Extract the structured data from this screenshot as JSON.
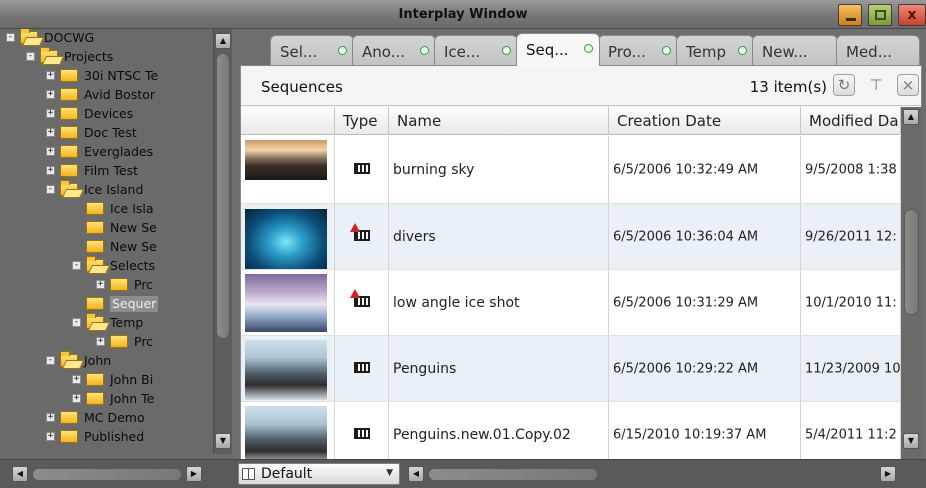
{
  "window": {
    "title": "Interplay Window",
    "close_glyph": "x"
  },
  "tree": [
    {
      "label": "DOCWG",
      "level": 0,
      "toggle": "-",
      "open": true
    },
    {
      "label": "Projects",
      "level": 1,
      "toggle": "-",
      "open": true
    },
    {
      "label": "30i NTSC Te",
      "level": 2,
      "toggle": "+",
      "open": false
    },
    {
      "label": "Avid Bostor",
      "level": 2,
      "toggle": "+",
      "open": false
    },
    {
      "label": "Devices",
      "level": 2,
      "toggle": "+",
      "open": false
    },
    {
      "label": "Doc Test",
      "level": 2,
      "toggle": "+",
      "open": false
    },
    {
      "label": "Everglades",
      "level": 2,
      "toggle": "+",
      "open": false
    },
    {
      "label": "Film Test",
      "level": 2,
      "toggle": "+",
      "open": false
    },
    {
      "label": "Ice Island",
      "level": 2,
      "toggle": "-",
      "open": true
    },
    {
      "label": "Ice Isla",
      "level": 3,
      "toggle": "",
      "open": false
    },
    {
      "label": "New Se",
      "level": 3,
      "toggle": "",
      "open": false
    },
    {
      "label": "New Se",
      "level": 3,
      "toggle": "",
      "open": false
    },
    {
      "label": "Selects",
      "level": 3,
      "toggle": "-",
      "open": true
    },
    {
      "label": "Prc",
      "level": 4,
      "toggle": "+",
      "open": false
    },
    {
      "label": "Sequer",
      "level": 3,
      "toggle": "",
      "open": false,
      "selected": true
    },
    {
      "label": "Temp",
      "level": 3,
      "toggle": "-",
      "open": true
    },
    {
      "label": "Prc",
      "level": 4,
      "toggle": "+",
      "open": false
    },
    {
      "label": "John",
      "level": 2,
      "toggle": "-",
      "open": true
    },
    {
      "label": "John Bi",
      "level": 3,
      "toggle": "+",
      "open": false
    },
    {
      "label": "John Te",
      "level": 3,
      "toggle": "+",
      "open": false
    },
    {
      "label": "MC Demo",
      "level": 2,
      "toggle": "+",
      "open": false
    },
    {
      "label": "Published",
      "level": 2,
      "toggle": "+",
      "open": false
    }
  ],
  "tabs": [
    {
      "label": "Sel...",
      "dot": true
    },
    {
      "label": "Ano...",
      "dot": true
    },
    {
      "label": "Ice...",
      "dot": true
    },
    {
      "label": "Seq...",
      "dot": true,
      "active": true
    },
    {
      "label": "Pro...",
      "dot": true
    },
    {
      "label": "Temp",
      "dot": true
    },
    {
      "label": "New...",
      "dot": false
    },
    {
      "label": "Med...",
      "dot": false
    }
  ],
  "panel": {
    "title": "Sequences",
    "item_count": "13 item(s)",
    "refresh_icon": "refresh-icon",
    "pin_icon": "pin-icon",
    "close_icon": "close-icon",
    "close_glyph": "×",
    "pin_glyph": "⊤",
    "refresh_glyph": "↻"
  },
  "columns": [
    "",
    "Type",
    "Name",
    "Creation Date",
    "Modified Da"
  ],
  "rows": [
    {
      "name": "burning sky",
      "created": "6/5/2006 10:32:49 AM",
      "modified": "9/5/2008 1:38",
      "flag": false,
      "thumb": "sky"
    },
    {
      "name": "divers",
      "created": "6/5/2006 10:36:04 AM",
      "modified": "9/26/2011 12:",
      "flag": true,
      "thumb": "underwater"
    },
    {
      "name": "low angle ice shot",
      "created": "6/5/2006 10:31:29 AM",
      "modified": "10/1/2010 11:",
      "flag": true,
      "thumb": "ice"
    },
    {
      "name": "Penguins",
      "created": "6/5/2006 10:29:22 AM",
      "modified": "11/23/2009 10",
      "flag": false,
      "thumb": "people"
    },
    {
      "name": "Penguins.new.01.Copy.02",
      "created": "6/15/2010 10:19:37 AM",
      "modified": "5/4/2011 11:2",
      "flag": false,
      "thumb": "people"
    }
  ],
  "footer": {
    "view": "Default"
  },
  "colors": {
    "accent_green": "#3a9a3a",
    "selection": "#8d8d8d",
    "flag_red": "#d42020"
  }
}
